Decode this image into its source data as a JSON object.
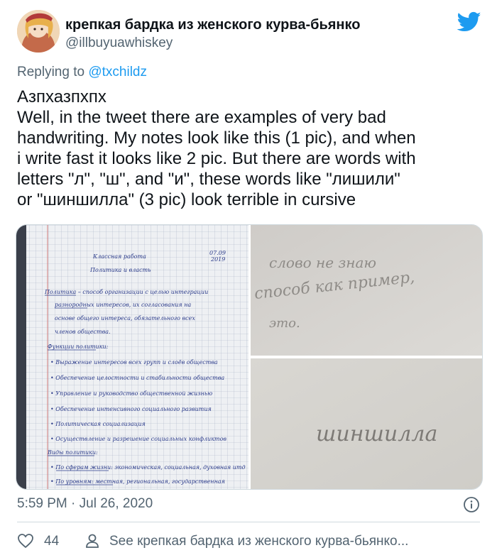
{
  "author": {
    "display_name": "крепкая бардка из женского курва-бьянко",
    "handle": "@illbuyuawhiskey",
    "avatar_icon": "avatar-illustration"
  },
  "reply": {
    "prefix": "Replying to ",
    "mention": "@txchildz"
  },
  "tweet": {
    "lines": [
      "Азпхазпхпх",
      "Well, in the tweet there are examples of very bad",
      "handwriting. My notes look like this (1 pic), and when",
      "i write fast it looks like 2 pic. But there are words with",
      "letters \"л\", \"ш\", and \"и\", these words like \"лишили\"",
      "or \"шиншилла\" (3 pic) look terrible in cursive"
    ]
  },
  "media": {
    "pic1": {
      "date": "07.09",
      "year": "2019",
      "title": "Классная работа",
      "subtitle": "Политика и власть",
      "lines": [
        "Политика – способ организации с целью интеграции",
        "разнородных интересов, их согласования на",
        "основе общего интереса, обязательного всех",
        "членов общества.",
        "Функции политики:",
        "• Выражение интересов всех групп и слоёв общества",
        "• Обеспечение целостности и стабильности общества",
        "• Управление и руководство общественной жизнью",
        "• Обеспечение интенсивного социального развития",
        "• Политическая социализация",
        "• Осуществление и разрешение социальных конфликтов",
        "Виды политики:",
        "• По сферам жизни: экономическая, социальная, духовная итд",
        "• По уровням: местная, региональная, государственная"
      ]
    },
    "pic2": {
      "lines": [
        "слово не знаю",
        "способ как пример,",
        "это."
      ]
    },
    "pic3": {
      "word": "шиншилла"
    }
  },
  "meta": {
    "timestamp": "5:59 PM · Jul 26, 2020"
  },
  "footer": {
    "likes": "44",
    "see_more": "See крепкая бардка из женского курва-бьянко..."
  },
  "colors": {
    "twitter_blue": "#1d9bf0",
    "secondary_text": "#536471"
  }
}
